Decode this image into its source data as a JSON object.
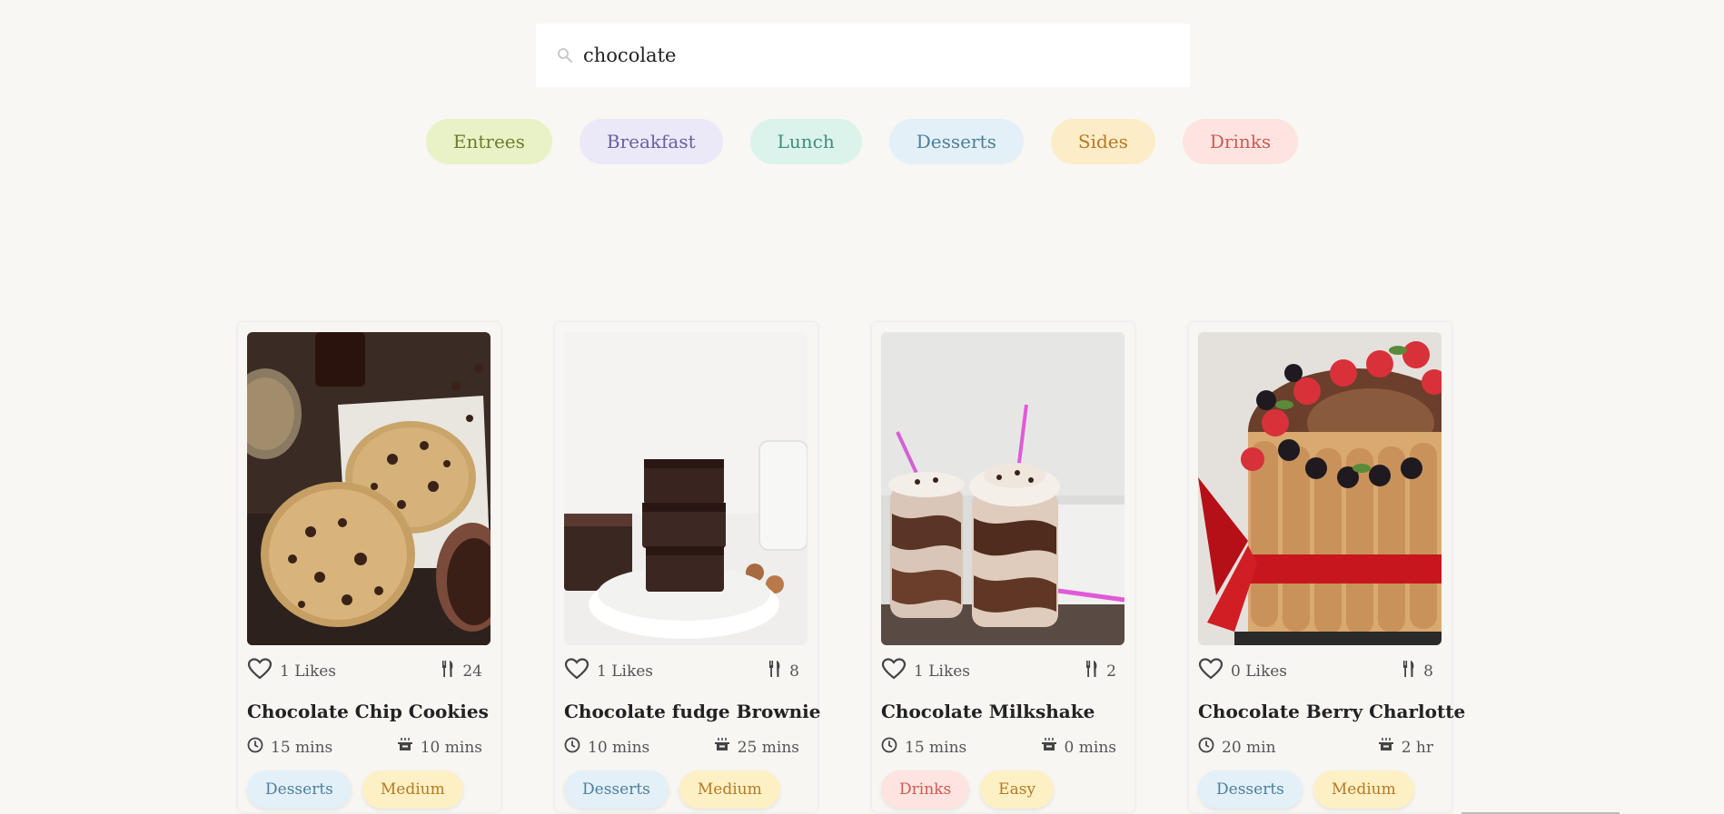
{
  "search": {
    "value": "chocolate",
    "placeholder": "Search recipes"
  },
  "categories": [
    {
      "label": "Entrees",
      "bg": "#e9f2c6",
      "fg": "#6b7d2f"
    },
    {
      "label": "Breakfast",
      "bg": "#ebe8f8",
      "fg": "#6b5fa0"
    },
    {
      "label": "Lunch",
      "bg": "#dcf3ec",
      "fg": "#3f8e7a"
    },
    {
      "label": "Desserts",
      "bg": "#e3f0f8",
      "fg": "#4d7f9b"
    },
    {
      "label": "Sides",
      "bg": "#fdecc8",
      "fg": "#b57a25"
    },
    {
      "label": "Drinks",
      "bg": "#fde4e0",
      "fg": "#cf5a52"
    }
  ],
  "recipes": [
    {
      "title": "Chocolate Chip Cookies",
      "likes": "1 Likes",
      "servings": "24",
      "prep": "15 mins",
      "cook": "10 mins",
      "tags": [
        {
          "label": "Desserts",
          "bg": "#e3f0f8",
          "fg": "#4d7f9b"
        },
        {
          "label": "Medium",
          "bg": "#fdf0c4",
          "fg": "#b57a25"
        }
      ]
    },
    {
      "title": "Chocolate fudge Brownie",
      "likes": "1 Likes",
      "servings": "8",
      "prep": "10 mins",
      "cook": "25 mins",
      "tags": [
        {
          "label": "Desserts",
          "bg": "#e3f0f8",
          "fg": "#4d7f9b"
        },
        {
          "label": "Medium",
          "bg": "#fdf0c4",
          "fg": "#b57a25"
        }
      ]
    },
    {
      "title": "Chocolate Milkshake",
      "likes": "1 Likes",
      "servings": "2",
      "prep": "15 mins",
      "cook": "0 mins",
      "tags": [
        {
          "label": "Drinks",
          "bg": "#fde4e0",
          "fg": "#cf5a52"
        },
        {
          "label": "Easy",
          "bg": "#fdf0c4",
          "fg": "#b57a25"
        }
      ]
    },
    {
      "title": "Chocolate Berry Charlotte",
      "likes": "0 Likes",
      "servings": "8",
      "prep": "20 min",
      "cook": "2 hr",
      "tags": [
        {
          "label": "Desserts",
          "bg": "#e3f0f8",
          "fg": "#4d7f9b"
        },
        {
          "label": "Medium",
          "bg": "#fdf0c4",
          "fg": "#b57a25"
        }
      ]
    }
  ],
  "icons": {
    "search": "search-icon",
    "like": "heart-icon",
    "servings": "fork-knife-icon",
    "prep": "clock-icon",
    "cook": "cooking-pot-icon"
  }
}
